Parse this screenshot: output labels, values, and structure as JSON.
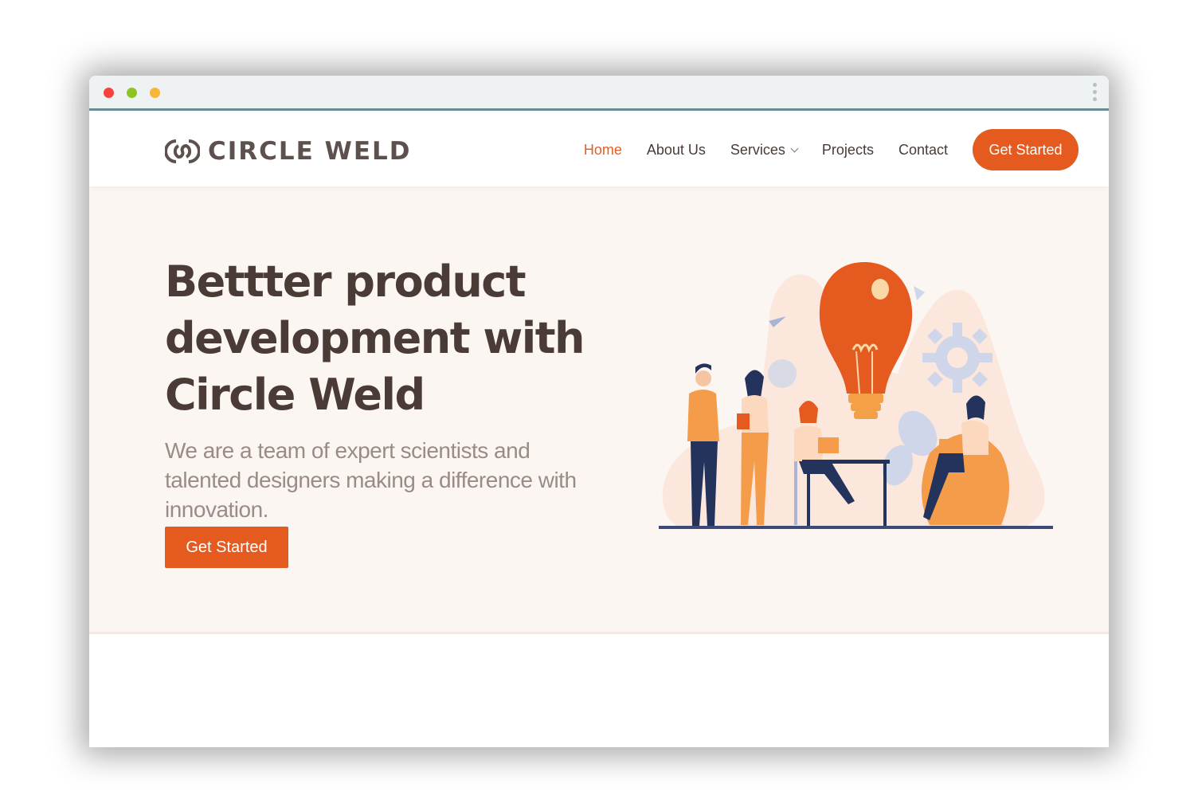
{
  "brand": {
    "name": "CIRCLE WELD",
    "accent": "#e55a1f",
    "text_dark": "#4a3b36",
    "hero_bg": "#fcf6f3"
  },
  "navbar": {
    "items": [
      {
        "label": "Home",
        "active": true
      },
      {
        "label": "About Us",
        "active": false
      },
      {
        "label": "Services",
        "active": false,
        "has_dropdown": true
      },
      {
        "label": "Projects",
        "active": false
      },
      {
        "label": "Contact",
        "active": false
      }
    ],
    "cta": "Get Started"
  },
  "hero": {
    "title_lines": [
      "Bettter product",
      "development with",
      "Circle Weld"
    ],
    "subtitle": "We are a team of expert scientists and talented designers making a difference with innovation.",
    "cta": "Get Started"
  },
  "icons": {
    "logo": "circle-weld-logo-icon",
    "services_chevron": "chevron-down-icon",
    "illustration": "team-lightbulb-illustration"
  }
}
